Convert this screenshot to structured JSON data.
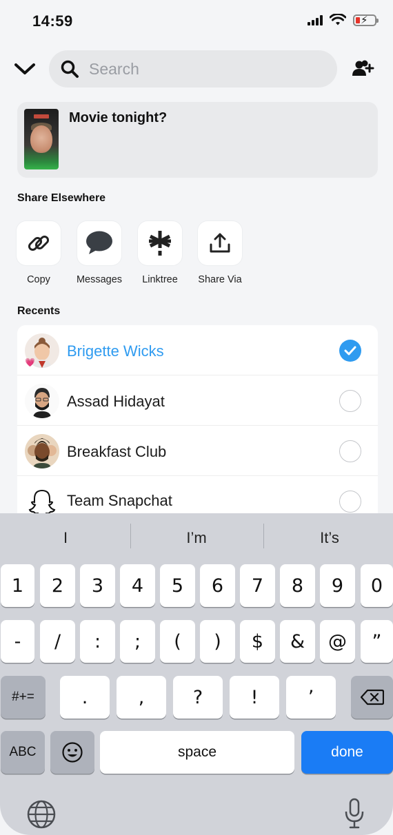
{
  "status_bar": {
    "time": "14:59"
  },
  "search": {
    "placeholder": "Search"
  },
  "preview": {
    "caption": "Movie tonight?"
  },
  "share_elsewhere": {
    "title": "Share Elsewhere",
    "items": [
      {
        "label": "Copy",
        "icon": "link-icon"
      },
      {
        "label": "Messages",
        "icon": "speech-bubble-icon"
      },
      {
        "label": "Linktree",
        "icon": "linktree-icon"
      },
      {
        "label": "Share Via",
        "icon": "share-upload-icon"
      }
    ]
  },
  "recents": {
    "title": "Recents",
    "items": [
      {
        "name": "Brigette Wicks",
        "selected": true
      },
      {
        "name": "Assad Hidayat",
        "selected": false
      },
      {
        "name": "Breakfast Club",
        "selected": false
      },
      {
        "name": "Team Snapchat",
        "selected": false
      }
    ]
  },
  "keyboard": {
    "suggestions": [
      "I",
      "I’m",
      "It’s"
    ],
    "row1": [
      "1",
      "2",
      "3",
      "4",
      "5",
      "6",
      "7",
      "8",
      "9",
      "0"
    ],
    "row2": [
      "-",
      "/",
      ":",
      ";",
      "(",
      ")",
      "$",
      "&",
      "@",
      "”"
    ],
    "row3": [
      ".",
      ",",
      "?",
      "!",
      "’"
    ],
    "symbols_key": "#+=",
    "abc_key": "ABC",
    "space_key": "space",
    "done_key": "done"
  },
  "colors": {
    "accent": "#2f9bf0",
    "done_blue": "#1a7cf5"
  }
}
